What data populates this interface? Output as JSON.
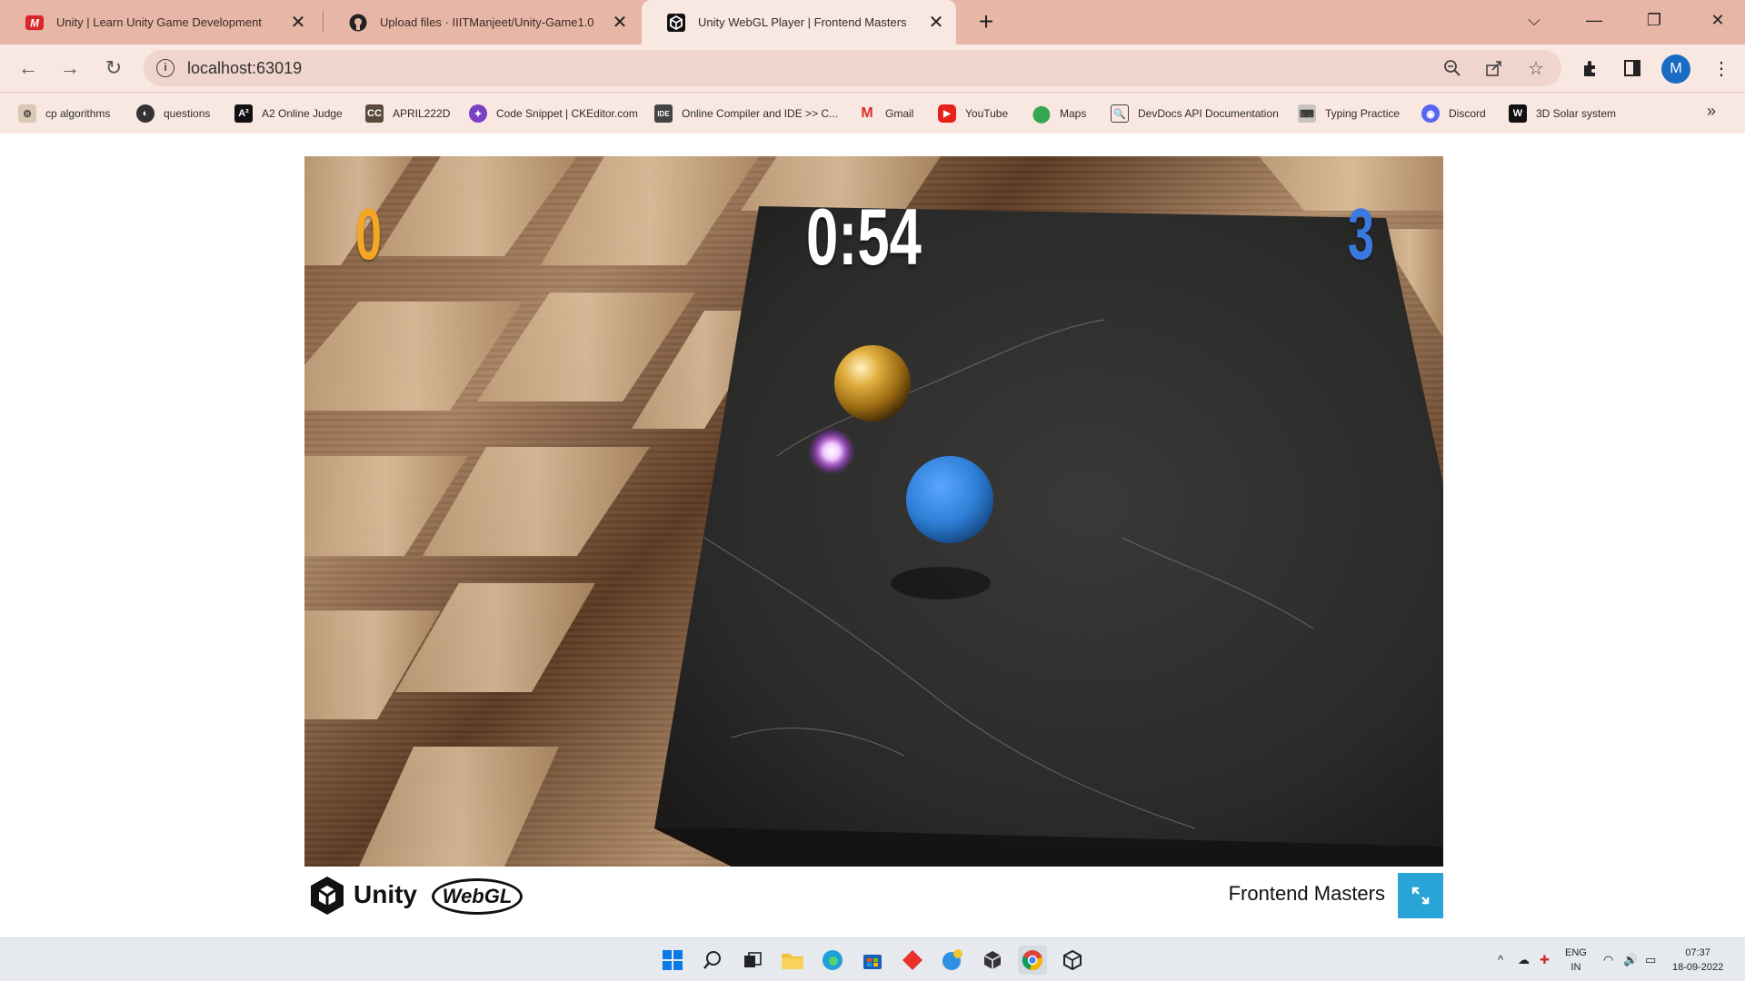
{
  "tabs": [
    {
      "title": "Unity | Learn Unity Game Development",
      "icon": "unity-learn-icon",
      "active": false
    },
    {
      "title": "Upload files · IIITManjeet/Unity-Game1.0",
      "icon": "github-icon",
      "active": false
    },
    {
      "title": "Unity WebGL Player | Frontend Masters",
      "icon": "unity-icon",
      "active": true
    }
  ],
  "address_bar": {
    "url": "localhost:63019"
  },
  "profile": {
    "initial": "M"
  },
  "bookmarks": [
    {
      "label": "cp algorithms",
      "icon": "cp-algorithms-icon"
    },
    {
      "label": "questions",
      "icon": "globe-icon"
    },
    {
      "label": "A2 Online Judge",
      "icon": "a2-icon"
    },
    {
      "label": "APRIL222D",
      "icon": "cc-icon"
    },
    {
      "label": "Code Snippet | CKEditor.com",
      "icon": "ckeditor-icon"
    },
    {
      "label": "Online Compiler and IDE >> C...",
      "icon": "ideone-icon"
    },
    {
      "label": "Gmail",
      "icon": "gmail-icon"
    },
    {
      "label": "YouTube",
      "icon": "youtube-icon"
    },
    {
      "label": "Maps",
      "icon": "maps-icon"
    },
    {
      "label": "DevDocs API Documentation",
      "icon": "devdocs-icon"
    },
    {
      "label": "Typing Practice",
      "icon": "typing-icon"
    },
    {
      "label": "Discord",
      "icon": "discord-icon"
    },
    {
      "label": "3D Solar system",
      "icon": "w-icon"
    }
  ],
  "game": {
    "score_left": "0",
    "timer": "0:54",
    "score_right": "3",
    "colors": {
      "left_score": "#f5a623",
      "right_score": "#3a7ae0",
      "gold_ball": "#c99320",
      "blue_ball": "#2f7fd6",
      "pickup": "#e39bff"
    }
  },
  "footer": {
    "unity_label": "Unity",
    "webgl_label": "WebGL",
    "product_name": "Frontend Masters"
  },
  "taskbar": {
    "lang_line1": "ENG",
    "lang_line2": "IN",
    "time": "07:37",
    "date": "18-09-2022"
  }
}
